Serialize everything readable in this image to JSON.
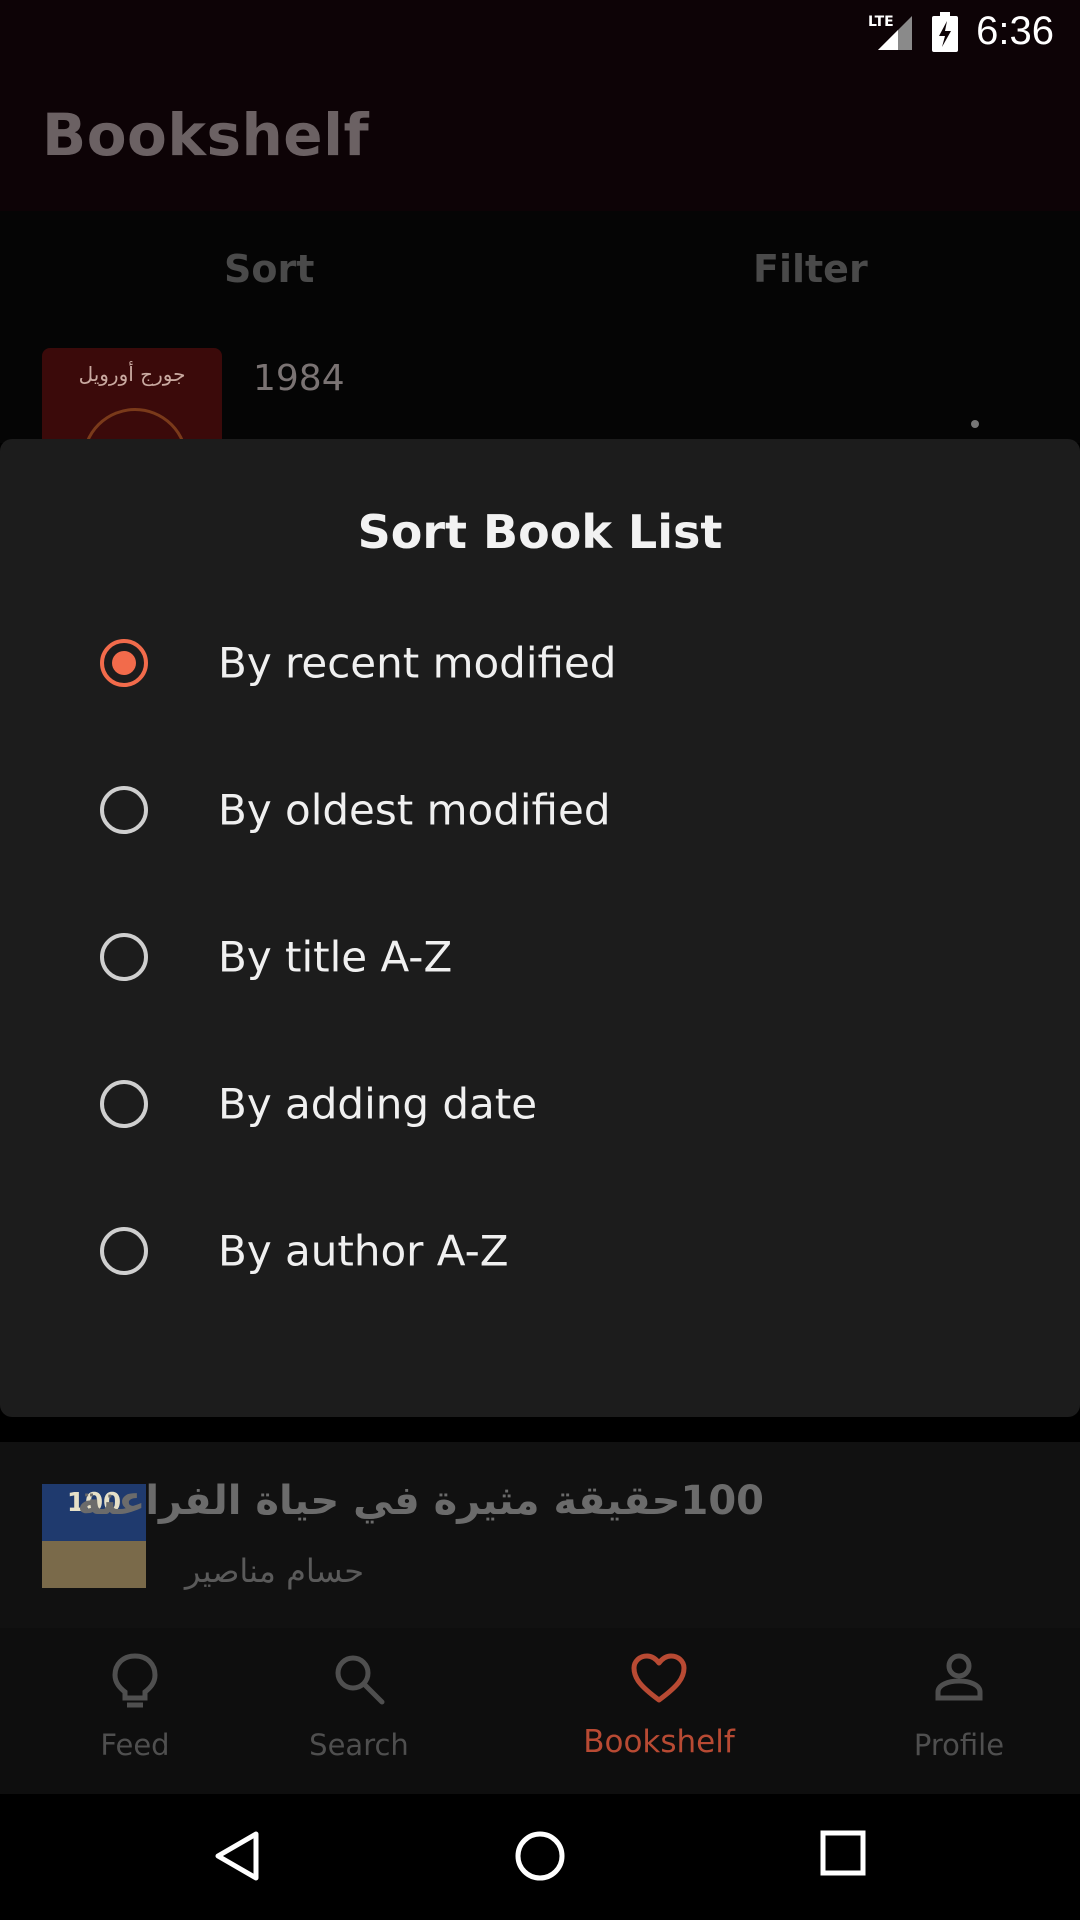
{
  "status_bar": {
    "time": "6:36",
    "network": "LTE",
    "signal_icon": "signal-icon",
    "battery_icon": "battery-charging-icon"
  },
  "app_bar": {
    "title": "Bookshelf"
  },
  "tabs": {
    "sort": "Sort",
    "filter": "Filter"
  },
  "books": [
    {
      "title": "1984",
      "cover_text": "جورج أورويل"
    },
    {
      "title": "100حقيقة مثيرة في حياة الفراعنة",
      "author": "حسام مناصير",
      "cover_text": "100"
    }
  ],
  "sort_sheet": {
    "title": "Sort Book List",
    "options": [
      {
        "label": "By recent modified",
        "selected": true
      },
      {
        "label": "By oldest modified",
        "selected": false
      },
      {
        "label": "By title A-Z",
        "selected": false
      },
      {
        "label": "By adding date",
        "selected": false
      },
      {
        "label": "By author A-Z",
        "selected": false
      }
    ]
  },
  "bottom_nav": {
    "items": [
      {
        "label": "Feed",
        "icon": "lightbulb-icon"
      },
      {
        "label": "Search",
        "icon": "search-icon"
      },
      {
        "label": "Bookshelf",
        "icon": "heart-icon",
        "active": true
      },
      {
        "label": "Profile",
        "icon": "person-icon"
      }
    ]
  },
  "colors": {
    "accent": "#f26b4b",
    "active_nav": "#b84a33",
    "sheet_bg": "#1c1c1c"
  }
}
